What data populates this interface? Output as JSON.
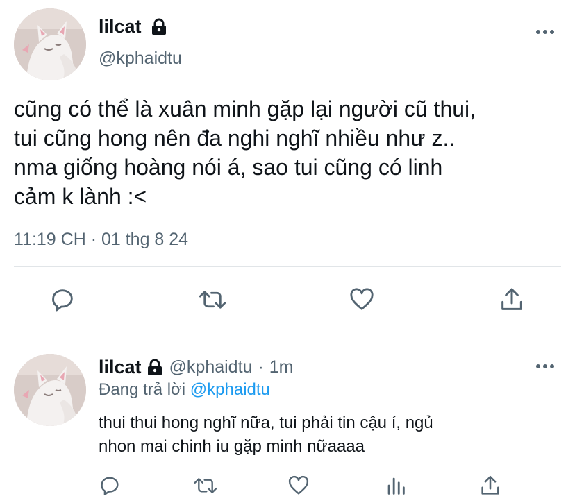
{
  "main_tweet": {
    "display_name": "lilcat",
    "handle": "@kphaidtu",
    "text_lines": [
      "cũng có thể là xuân minh gặp lại người cũ thui,",
      "tui cũng hong nên đa nghi nghĩ nhiều như z..",
      "nma giống hoàng nói á, sao tui cũng có linh",
      "cảm k lành :<"
    ],
    "timestamp": "11:19 CH · 01 thg 8 24",
    "actions": [
      "reply-icon",
      "retweet-icon",
      "like-icon",
      "share-icon"
    ]
  },
  "reply_tweet": {
    "display_name": "lilcat",
    "handle": "@kphaidtu",
    "separator": "·",
    "age": "1m",
    "replying_prefix": "Đang trả lời",
    "replying_to": "@kphaidtu",
    "text_lines": [
      "thui thui hong nghĩ nữa, tui phải tin cậu í, ngủ",
      "nhon mai chinh iu gặp minh nữaaaa"
    ],
    "actions": [
      "reply-icon",
      "retweet-icon",
      "like-icon",
      "analytics-icon",
      "share-icon"
    ]
  },
  "colors": {
    "text_primary": "#0f1419",
    "text_secondary": "#536471",
    "link": "#1d9bf0",
    "divider": "#e1e5e8"
  }
}
